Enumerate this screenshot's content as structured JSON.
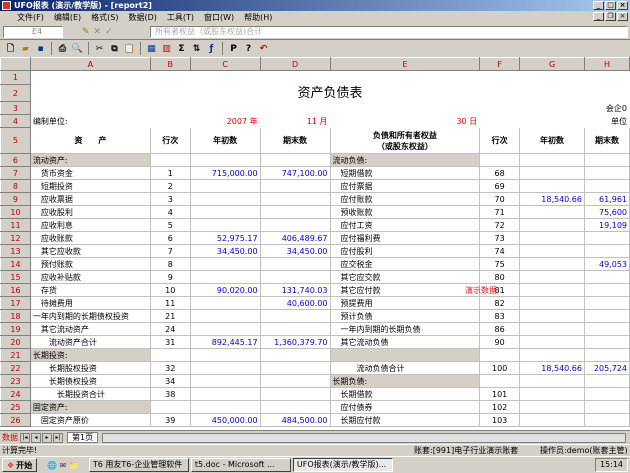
{
  "window": {
    "title": "UFO报表 (演示/教学版) - [report2]"
  },
  "menu": [
    "文件(F)",
    "编辑(E)",
    "格式(S)",
    "数据(D)",
    "工具(T)",
    "窗口(W)",
    "帮助(H)"
  ],
  "formula": {
    "cell": "E4",
    "content": "所有者权益（或股东权益)合计"
  },
  "columns": [
    "A",
    "B",
    "C",
    "D",
    "E",
    "F",
    "G",
    "H"
  ],
  "report": {
    "title": "资产负债表",
    "unit_label": "编制单位:",
    "corner_text": "会企0",
    "unit_note": "单位",
    "year": "2007 年",
    "month": "11 月",
    "day": "30 日"
  },
  "headers": {
    "asset": "资　　产",
    "line": "行次",
    "begin": "年初数",
    "end": "期末数",
    "liab": "负债和所有者权益",
    "liab2": "（或股东权益）",
    "line2": "行次",
    "begin2": "年初数",
    "end2": "期末数"
  },
  "rows": [
    {
      "n": "6",
      "a": "流动资产:",
      "b": "",
      "c": "",
      "d": "",
      "e": "流动负债:",
      "f": "",
      "g": "",
      "h": ""
    },
    {
      "n": "7",
      "a": "　货币资金",
      "b": "1",
      "c": "715,000.00",
      "d": "747,100.00",
      "e": "　短期借款",
      "f": "68",
      "g": "",
      "h": ""
    },
    {
      "n": "8",
      "a": "　短期投资",
      "b": "2",
      "c": "",
      "d": "",
      "e": "　应付票据",
      "f": "69",
      "g": "",
      "h": ""
    },
    {
      "n": "9",
      "a": "　应收票据",
      "b": "3",
      "c": "",
      "d": "",
      "e": "　应付账款",
      "f": "70",
      "g": "18,540.66",
      "h": "61,961"
    },
    {
      "n": "10",
      "a": "　应收股利",
      "b": "4",
      "c": "",
      "d": "",
      "e": "　预收账款",
      "f": "71",
      "g": "",
      "h": "75,600"
    },
    {
      "n": "11",
      "a": "　应收利息",
      "b": "5",
      "c": "",
      "d": "",
      "e": "　应付工资",
      "f": "72",
      "g": "",
      "h": "19,109"
    },
    {
      "n": "12",
      "a": "　应收账款",
      "b": "6",
      "c": "52,975.17",
      "d": "406,489.67",
      "e": "　应付福利费",
      "f": "73",
      "g": "",
      "h": ""
    },
    {
      "n": "13",
      "a": "　其它应收款",
      "b": "7",
      "c": "34,450.00",
      "d": "34,450.00",
      "e": "　应付股利",
      "f": "74",
      "g": "",
      "h": ""
    },
    {
      "n": "14",
      "a": "　预付账款",
      "b": "8",
      "c": "",
      "d": "",
      "e": "　应交税金",
      "f": "75",
      "g": "",
      "h": "49,053"
    },
    {
      "n": "15",
      "a": "　应收补贴款",
      "b": "9",
      "c": "",
      "d": "",
      "e": "　其它应交款",
      "f": "80",
      "g": "",
      "h": ""
    },
    {
      "n": "16",
      "a": "　存货",
      "b": "10",
      "c": "90,020.00",
      "d": "131,740.03",
      "e": "　其它应付款",
      "f": "81",
      "g": "",
      "h": ""
    },
    {
      "n": "17",
      "a": "　待摊费用",
      "b": "11",
      "c": "",
      "d": "40,600.00",
      "e": "　预提费用",
      "f": "82",
      "g": "",
      "h": ""
    },
    {
      "n": "18",
      "a": "一年内到期的长期债权投资",
      "b": "21",
      "c": "",
      "d": "",
      "e": "　预计负债",
      "f": "83",
      "g": "",
      "h": ""
    },
    {
      "n": "19",
      "a": "　其它流动资产",
      "b": "24",
      "c": "",
      "d": "",
      "e": "　一年内到期的长期负债",
      "f": "86",
      "g": "",
      "h": ""
    },
    {
      "n": "20",
      "a": "　　流动资产合计",
      "b": "31",
      "c": "892,445.17",
      "d": "1,360,379.70",
      "e": "　其它流动负债",
      "f": "90",
      "g": "",
      "h": ""
    },
    {
      "n": "21",
      "a": "长期投资:",
      "b": "",
      "c": "",
      "d": "",
      "e": "",
      "f": "",
      "g": "",
      "h": ""
    },
    {
      "n": "22",
      "a": "　　长期股权投资",
      "b": "32",
      "c": "",
      "d": "",
      "e": "　　　流动负债合计",
      "f": "100",
      "g": "18,540.66",
      "h": "205,724"
    },
    {
      "n": "23",
      "a": "　　长期债权投资",
      "b": "34",
      "c": "",
      "d": "",
      "e": "长期负债:",
      "f": "",
      "g": "",
      "h": ""
    },
    {
      "n": "24",
      "a": "　　　长期投资合计",
      "b": "38",
      "c": "",
      "d": "",
      "e": "　长期借款",
      "f": "101",
      "g": "",
      "h": ""
    },
    {
      "n": "25",
      "a": "固定资产:",
      "b": "",
      "c": "",
      "d": "",
      "e": "　应付债券",
      "f": "102",
      "g": "",
      "h": ""
    },
    {
      "n": "26",
      "a": "　固定资产原价",
      "b": "39",
      "c": "450,000.00",
      "d": "484,500.00",
      "e": "　长期应付款",
      "f": "103",
      "g": "",
      "h": ""
    }
  ],
  "demo_watermark": "演示数据",
  "sheet_tab": "第1页",
  "status": {
    "left": "计算完毕!",
    "left2": "数据",
    "account": "账套:[991]电子行业演示账套",
    "operator": "操作员:demo(账套主管)"
  },
  "taskbar": {
    "start": "开始",
    "tasks": [
      "T6 用友T6-企业管理软件",
      "t5.doc - Microsoft ...",
      "UFO报表(演示/教学版)..."
    ],
    "clock": "15:14"
  }
}
